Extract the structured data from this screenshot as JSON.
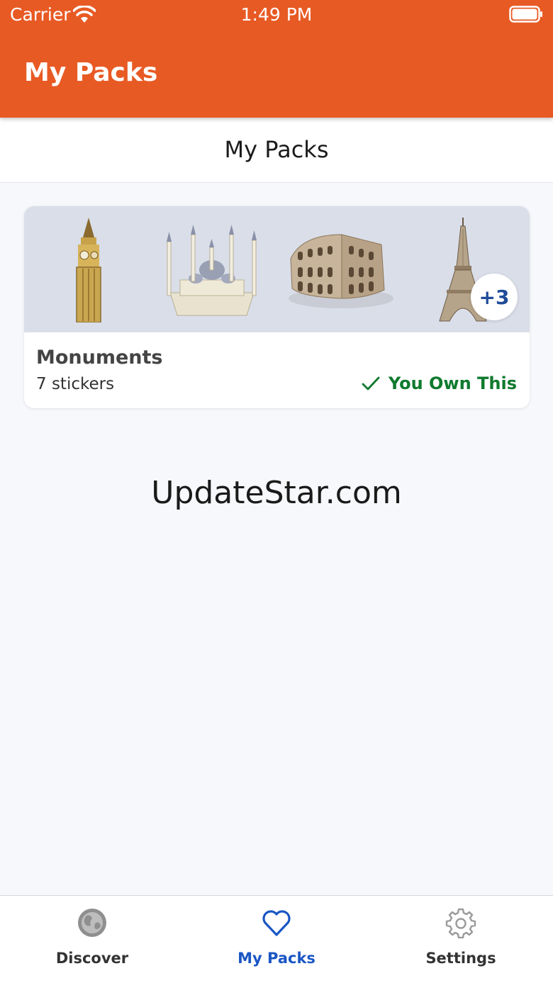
{
  "status_bar": {
    "carrier": "Carrier",
    "time": "1:49 PM"
  },
  "header": {
    "title": "My Packs"
  },
  "sub_header": {
    "title": "My Packs"
  },
  "pack": {
    "name": "Monuments",
    "count": "7 stickers",
    "more_badge": "+3",
    "owned_label": "You Own This",
    "stickers": [
      "big-ben-icon",
      "mosque-icon",
      "colosseum-icon",
      "eiffel-tower-icon"
    ]
  },
  "watermark": "UpdateStar.com",
  "tabs": [
    {
      "label": "Discover",
      "icon": "globe-icon",
      "active": false
    },
    {
      "label": "My Packs",
      "icon": "heart-icon",
      "active": true
    },
    {
      "label": "Settings",
      "icon": "gear-icon",
      "active": false
    }
  ],
  "colors": {
    "header": "#e85a24",
    "owned": "#0f7a2e",
    "active_tab": "#1a56c4",
    "badge_text": "#1f4b99"
  }
}
